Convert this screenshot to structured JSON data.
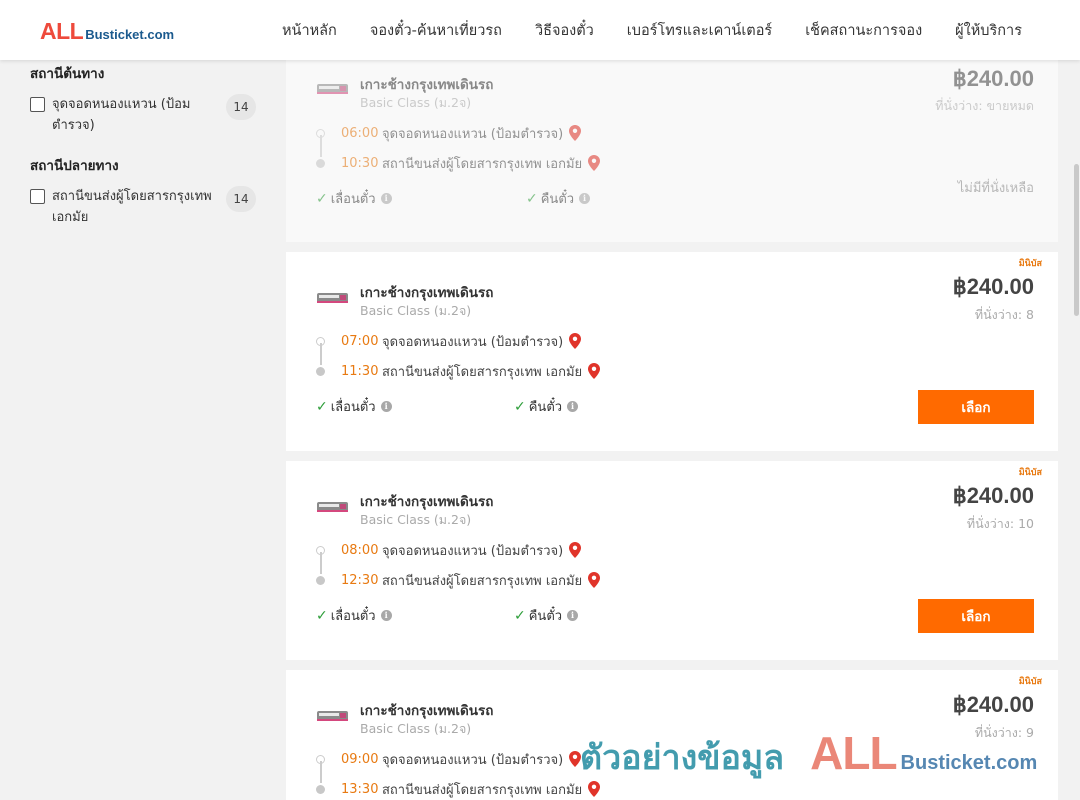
{
  "header": {
    "logo_main": "ALL",
    "logo_sub": "Busticket.com",
    "nav": [
      "หน้าหลัก",
      "จองตั๋ว-ค้นหาเที่ยวรถ",
      "วิธีจองตั๋ว",
      "เบอร์โทรและเคาน์เตอร์",
      "เช็คสถานะการจอง",
      "ผู้ให้บริการ"
    ]
  },
  "sidebar": {
    "origin_title": "สถานีต้นทาง",
    "origin_option": "จุดจอดหนองแหวน (ป้อมตำรวจ)",
    "origin_count": "14",
    "dest_title": "สถานีปลายทาง",
    "dest_option": "สถานีขนส่งผู้โดยสารกรุงเทพ เอกมัย",
    "dest_count": "14"
  },
  "trips": [
    {
      "operator": "เกาะช้างกรุงเทพเดินรถ",
      "class": "Basic Class (ม.2จ)",
      "depart_time": "06:00",
      "depart_place": "จุดจอดหนองแหวน (ป้อมตำรวจ)",
      "arrive_time": "10:30",
      "arrive_place": "สถานีขนส่งผู้โดยสารกรุงเทพ เอกมัย",
      "feature1": "เลื่อนตั๋ว",
      "feature2": "คืนตั๋ว",
      "price": "฿240.00",
      "seats": "ที่นั่งว่าง: ขายหมด",
      "status": "ไม่มีที่นั่งเหลือ",
      "badge": ""
    },
    {
      "operator": "เกาะช้างกรุงเทพเดินรถ",
      "class": "Basic Class (ม.2จ)",
      "depart_time": "07:00",
      "depart_place": "จุดจอดหนองแหวน (ป้อมตำรวจ)",
      "arrive_time": "11:30",
      "arrive_place": "สถานีขนส่งผู้โดยสารกรุงเทพ เอกมัย",
      "feature1": "เลื่อนตั๋ว",
      "feature2": "คืนตั๋ว",
      "price": "฿240.00",
      "seats": "ที่นั่งว่าง: 8",
      "button": "เลือก",
      "badge": "มินิบัส"
    },
    {
      "operator": "เกาะช้างกรุงเทพเดินรถ",
      "class": "Basic Class (ม.2จ)",
      "depart_time": "08:00",
      "depart_place": "จุดจอดหนองแหวน (ป้อมตำรวจ)",
      "arrive_time": "12:30",
      "arrive_place": "สถานีขนส่งผู้โดยสารกรุงเทพ เอกมัย",
      "feature1": "เลื่อนตั๋ว",
      "feature2": "คืนตั๋ว",
      "price": "฿240.00",
      "seats": "ที่นั่งว่าง: 10",
      "button": "เลือก",
      "badge": "มินิบัส"
    },
    {
      "operator": "เกาะช้างกรุงเทพเดินรถ",
      "class": "Basic Class (ม.2จ)",
      "depart_time": "09:00",
      "depart_place": "จุดจอดหนองแหวน (ป้อมตำรวจ)",
      "arrive_time": "13:30",
      "arrive_place": "สถานีขนส่งผู้โดยสารกรุงเทพ เอกมัย",
      "price": "฿240.00",
      "seats": "ที่นั่งว่าง: 9",
      "badge": "มินิบัส"
    }
  ],
  "watermark": {
    "text": "ตัวอย่างข้อมูล",
    "brand_main": "ALL",
    "brand_sub": "Busticket.com"
  },
  "colors": {
    "accent": "#ff6a00",
    "time": "#e87a12",
    "pin": "#e0342a",
    "check": "#2e9e3a"
  }
}
